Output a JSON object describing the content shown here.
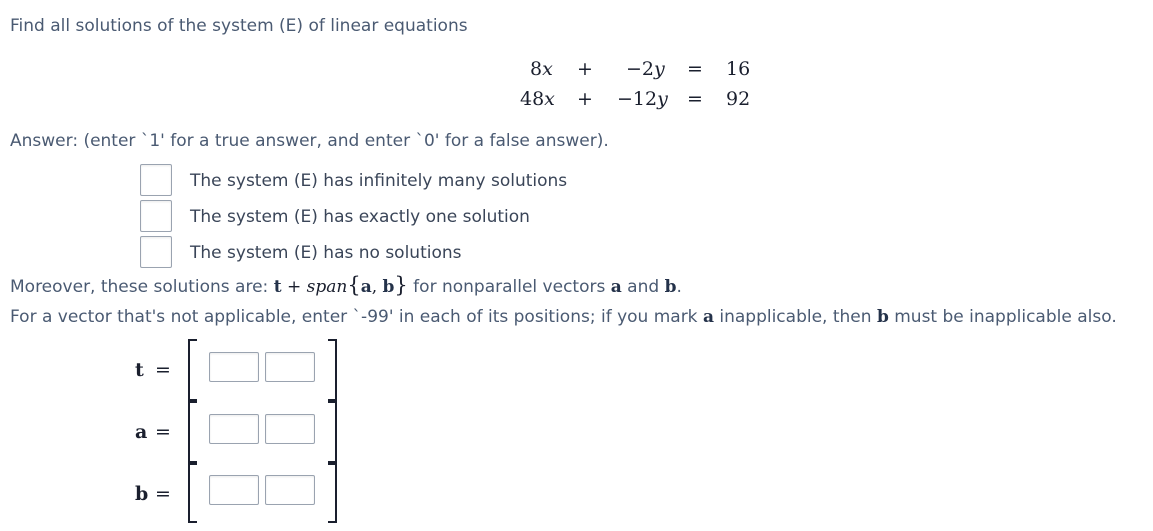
{
  "prompt": "Find all solutions of the system (E) of linear equations",
  "equations": [
    {
      "a": "8𝑥",
      "op": "+",
      "b": "−2𝑦",
      "eq": "=",
      "rhs": "16"
    },
    {
      "a": "48𝑥",
      "op": "+",
      "b": "−12𝑦",
      "eq": "=",
      "rhs": "92"
    }
  ],
  "answer_instruction": "Answer: (enter `1' for a true answer, and enter `0' for a false answer).",
  "options": [
    {
      "label": "The system (E) has infinitely many solutions",
      "value": ""
    },
    {
      "label": "The system (E) has exactly one solution",
      "value": ""
    },
    {
      "label": "The system (E) has no solutions",
      "value": ""
    }
  ],
  "moreover": {
    "prefix": "Moreover, these solutions are: ",
    "t": "t",
    "plus": " + ",
    "span": "span",
    "set_open": "{",
    "a": "a",
    "comma": ", ",
    "b": "b",
    "set_close": "}",
    "middle": " for nonparallel vectors ",
    "and": " and ",
    "end": "."
  },
  "note": {
    "prefix": "For a vector that's not applicable, enter `-99' in each of its positions; if you mark ",
    "a": "a",
    "middle": " inapplicable, then ",
    "b": "b",
    "end": " must be inapplicable also."
  },
  "vectors": [
    {
      "name": "t",
      "eq": "=",
      "entries": [
        "",
        ""
      ]
    },
    {
      "name": "a",
      "eq": "=",
      "entries": [
        "",
        ""
      ]
    },
    {
      "name": "b",
      "eq": "=",
      "entries": [
        "",
        ""
      ]
    }
  ]
}
